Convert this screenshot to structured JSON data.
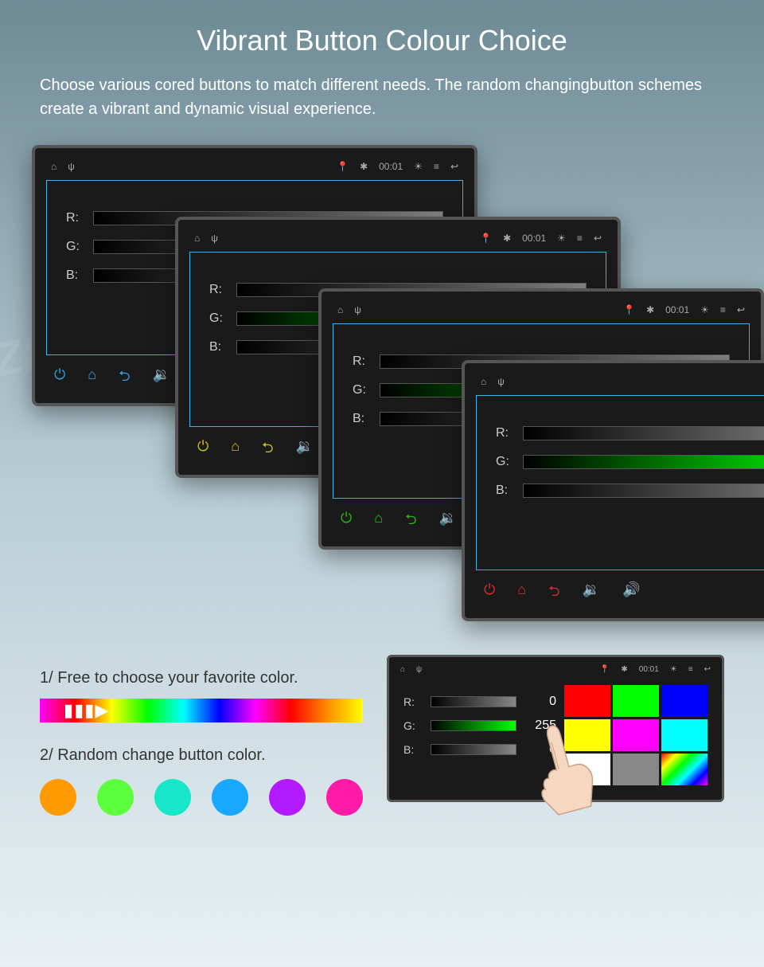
{
  "header": {
    "title": "Vibrant Button Colour Choice",
    "desc": "Choose various cored buttons to match different needs. The random changingbutton schemes create a vibrant and dynamic visual experience."
  },
  "statusbar": {
    "time": "00:01"
  },
  "rgb_labels": {
    "r": "R:",
    "g": "G:",
    "b": "B:"
  },
  "rgb_values": {
    "r": "0",
    "g": "255",
    "b": "0"
  },
  "bottom": {
    "line1": "1/ Free to choose your favorite color.",
    "line2": "2/ Random change button color."
  },
  "dot_colors": [
    "#ff9a00",
    "#5cff3d",
    "#18e6c8",
    "#1aa7ff",
    "#b21aff",
    "#ff1aa7"
  ],
  "swatches_right": [
    "#f00",
    "#ff0",
    "#fff"
  ],
  "palette": [
    "#f00",
    "#0f0",
    "#00f",
    "#ff0",
    "#f0f",
    "#0ff",
    "#fff",
    "#888",
    "rainbow"
  ],
  "watermark": "ZBARK"
}
